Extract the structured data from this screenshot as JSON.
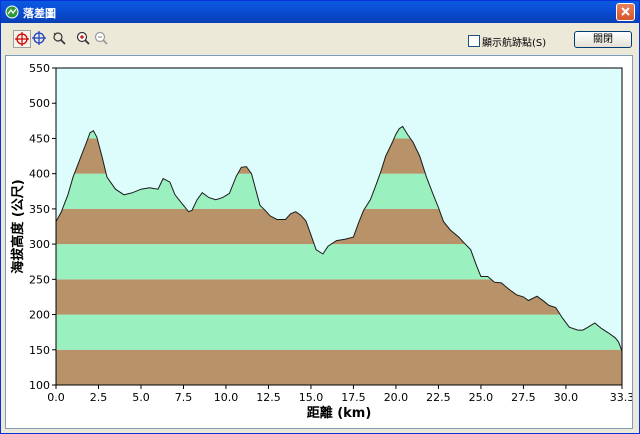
{
  "window": {
    "title": "落差圖"
  },
  "toolbar": {
    "tools": [
      {
        "icon": "crosshair-red-icon",
        "active": true
      },
      {
        "icon": "crosshair-blue-icon",
        "active": false
      },
      {
        "icon": "pan-icon",
        "active": false
      },
      {
        "icon": "zoom-in-icon",
        "active": false
      },
      {
        "icon": "zoom-out-icon",
        "active": false
      }
    ],
    "show_waypoints_label": "顯示航跡點(S)",
    "show_waypoints_checked": false,
    "close_label": "關閉"
  },
  "chart_data": {
    "type": "area",
    "xlabel": "距離 (km)",
    "ylabel": "海拔高度 (公尺)",
    "xlim": [
      0,
      33.3
    ],
    "ylim": [
      100,
      550
    ],
    "xticks": [
      "0.0",
      "2.5",
      "5.0",
      "7.5",
      "10.0",
      "12.5",
      "15.0",
      "17.5",
      "20.0",
      "22.5",
      "25.0",
      "27.5",
      "30.0",
      "33.3"
    ],
    "yticks": [
      "100",
      "150",
      "200",
      "250",
      "300",
      "350",
      "400",
      "450",
      "500",
      "550"
    ],
    "band_height": 50,
    "colors": {
      "background": "#ddfcfc",
      "band_brown": "#b89269",
      "band_green": "#9bf0bf",
      "line": "#1a1a1a"
    },
    "x": [
      0,
      0.3,
      0.7,
      1.0,
      1.4,
      1.8,
      2.0,
      2.2,
      2.4,
      2.7,
      3.0,
      3.5,
      4.0,
      4.5,
      5.0,
      5.5,
      6.0,
      6.3,
      6.7,
      7.0,
      7.5,
      7.8,
      8.0,
      8.3,
      8.6,
      9.0,
      9.4,
      9.8,
      10.2,
      10.6,
      10.9,
      11.2,
      11.5,
      11.8,
      12.0,
      12.3,
      12.6,
      13.0,
      13.5,
      13.8,
      14.1,
      14.4,
      14.7,
      15.0,
      15.3,
      15.7,
      16.0,
      16.5,
      17.0,
      17.5,
      17.8,
      18.1,
      18.5,
      18.8,
      19.1,
      19.4,
      19.8,
      20.0,
      20.2,
      20.4,
      20.7,
      21.0,
      21.4,
      21.8,
      22.2,
      22.5,
      22.8,
      23.2,
      23.7,
      24.0,
      24.4,
      24.7,
      25.0,
      25.4,
      25.8,
      26.2,
      26.7,
      27.1,
      27.5,
      27.8,
      28.3,
      28.7,
      29.0,
      29.4,
      29.8,
      30.2,
      30.7,
      31.0,
      31.3,
      31.7,
      32.1,
      32.5,
      32.9,
      33.1,
      33.3
    ],
    "y": [
      332,
      345,
      370,
      395,
      420,
      445,
      458,
      461,
      452,
      425,
      395,
      378,
      370,
      373,
      378,
      380,
      378,
      393,
      388,
      370,
      355,
      346,
      348,
      363,
      373,
      366,
      363,
      366,
      372,
      396,
      409,
      410,
      400,
      373,
      355,
      348,
      340,
      335,
      335,
      343,
      346,
      341,
      333,
      313,
      292,
      286,
      297,
      305,
      307,
      310,
      330,
      348,
      363,
      382,
      402,
      425,
      445,
      456,
      464,
      467,
      455,
      445,
      425,
      395,
      370,
      352,
      332,
      320,
      310,
      302,
      292,
      272,
      254,
      254,
      246,
      245,
      235,
      228,
      225,
      220,
      226,
      219,
      213,
      210,
      195,
      182,
      178,
      178,
      182,
      188,
      180,
      174,
      167,
      161,
      148
    ]
  }
}
